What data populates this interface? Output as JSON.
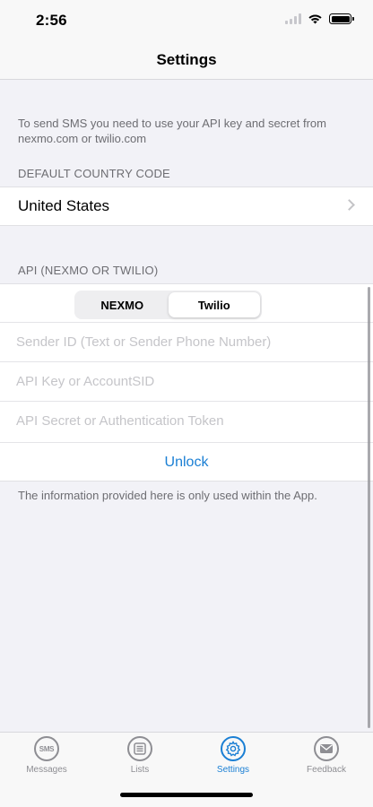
{
  "status_bar": {
    "time": "2:56"
  },
  "nav": {
    "title": "Settings"
  },
  "intro": "To send SMS you need to  use your API key and secret from nexmo.com or twilio.com",
  "country_section": {
    "header": "DEFAULT COUNTRY CODE",
    "value": "United States"
  },
  "api_section": {
    "header": "API (NEXMO OR TWILIO)",
    "segments": [
      "NEXMO",
      "Twilio"
    ],
    "selected_segment": "Twilio",
    "fields": {
      "sender_placeholder": "Sender ID (Text or Sender Phone Number)",
      "key_placeholder": "API Key or AccountSID",
      "secret_placeholder": "API Secret or Authentication Token"
    },
    "unlock_label": "Unlock"
  },
  "footer": "The information provided here is only used within the App.",
  "tab_bar": {
    "tabs": [
      {
        "label": "Messages",
        "icon": "sms-icon"
      },
      {
        "label": "Lists",
        "icon": "list-icon"
      },
      {
        "label": "Settings",
        "icon": "gear-icon"
      },
      {
        "label": "Feedback",
        "icon": "mail-icon"
      }
    ],
    "active": "Settings",
    "sms_glyph": "SMS"
  },
  "colors": {
    "accent": "#1a7fd4",
    "background": "#f2f2f7",
    "secondary_text": "#6d6d72"
  }
}
